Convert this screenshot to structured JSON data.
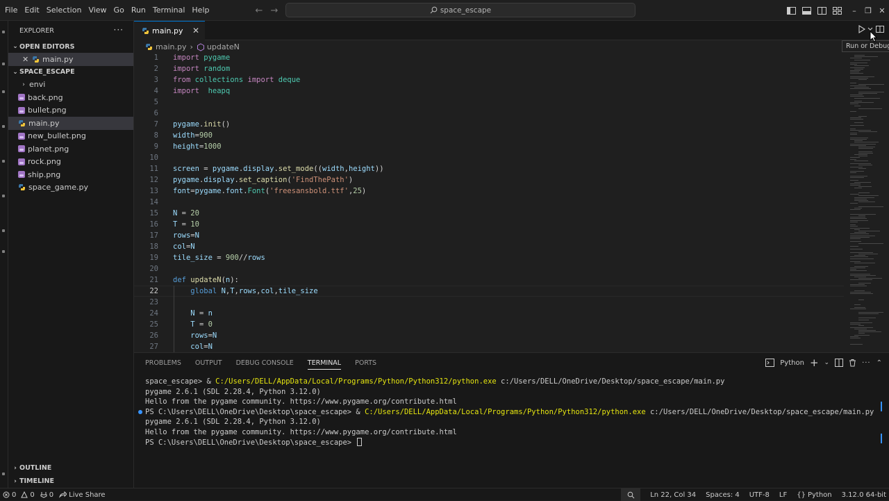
{
  "menu": [
    "File",
    "Edit",
    "Selection",
    "View",
    "Go",
    "Run",
    "Terminal",
    "Help"
  ],
  "search": {
    "label": "space_escape"
  },
  "sidebar": {
    "title": "EXPLORER",
    "open_editors": {
      "title": "OPEN EDITORS",
      "items": [
        {
          "name": "main.py"
        }
      ]
    },
    "folder": {
      "title": "SPACE_ESCAPE",
      "items": [
        {
          "name": "envi",
          "type": "folder"
        },
        {
          "name": "back.png",
          "type": "image"
        },
        {
          "name": "bullet.png",
          "type": "image"
        },
        {
          "name": "main.py",
          "type": "python",
          "selected": true
        },
        {
          "name": "new_bullet.png",
          "type": "image"
        },
        {
          "name": "planet.png",
          "type": "image"
        },
        {
          "name": "rock.png",
          "type": "image"
        },
        {
          "name": "ship.png",
          "type": "image"
        },
        {
          "name": "space_game.py",
          "type": "python"
        }
      ]
    },
    "outline": "OUTLINE",
    "timeline": "TIMELINE"
  },
  "tab": {
    "label": "main.py",
    "close": "✕"
  },
  "breadcrumb": {
    "file": "main.py",
    "separator": "›",
    "symbol": "updateN"
  },
  "tooltip": "Run or Debug",
  "editor": {
    "current_line": 22,
    "lines": [
      {
        "n": "1",
        "tokens": [
          [
            "kw",
            "import"
          ],
          [
            "op",
            " "
          ],
          [
            "mod",
            "pygame"
          ]
        ]
      },
      {
        "n": "2",
        "tokens": [
          [
            "kw",
            "import"
          ],
          [
            "op",
            " "
          ],
          [
            "mod",
            "random"
          ]
        ]
      },
      {
        "n": "3",
        "tokens": [
          [
            "kw",
            "from"
          ],
          [
            "op",
            " "
          ],
          [
            "mod",
            "collections"
          ],
          [
            "op",
            " "
          ],
          [
            "kw",
            "import"
          ],
          [
            "op",
            " "
          ],
          [
            "mod",
            "deque"
          ]
        ]
      },
      {
        "n": "4",
        "tokens": [
          [
            "kw",
            "import"
          ],
          [
            "op",
            "  "
          ],
          [
            "mod",
            "heapq"
          ]
        ]
      },
      {
        "n": "5",
        "tokens": []
      },
      {
        "n": "6",
        "tokens": []
      },
      {
        "n": "7",
        "tokens": [
          [
            "var",
            "pygame"
          ],
          [
            "op",
            "."
          ],
          [
            "fn",
            "init"
          ],
          [
            "op",
            "()"
          ]
        ]
      },
      {
        "n": "8",
        "tokens": [
          [
            "var",
            "width"
          ],
          [
            "op",
            "="
          ],
          [
            "num",
            "900"
          ]
        ]
      },
      {
        "n": "9",
        "tokens": [
          [
            "var",
            "height"
          ],
          [
            "op",
            "="
          ],
          [
            "num",
            "1000"
          ]
        ]
      },
      {
        "n": "10",
        "tokens": []
      },
      {
        "n": "11",
        "tokens": [
          [
            "var",
            "screen"
          ],
          [
            "op",
            " = "
          ],
          [
            "var",
            "pygame"
          ],
          [
            "op",
            "."
          ],
          [
            "var",
            "display"
          ],
          [
            "op",
            "."
          ],
          [
            "fn",
            "set_mode"
          ],
          [
            "op",
            "(("
          ],
          [
            "var",
            "width"
          ],
          [
            "op",
            ","
          ],
          [
            "var",
            "height"
          ],
          [
            "op",
            "))"
          ]
        ]
      },
      {
        "n": "12",
        "tokens": [
          [
            "var",
            "pygame"
          ],
          [
            "op",
            "."
          ],
          [
            "var",
            "display"
          ],
          [
            "op",
            "."
          ],
          [
            "fn",
            "set_caption"
          ],
          [
            "op",
            "("
          ],
          [
            "str",
            "'FindThePath'"
          ],
          [
            "op",
            ")"
          ]
        ]
      },
      {
        "n": "13",
        "tokens": [
          [
            "var",
            "font"
          ],
          [
            "op",
            "="
          ],
          [
            "var",
            "pygame"
          ],
          [
            "op",
            "."
          ],
          [
            "var",
            "font"
          ],
          [
            "op",
            "."
          ],
          [
            "mod",
            "Font"
          ],
          [
            "op",
            "("
          ],
          [
            "str",
            "'freesansbold.ttf'"
          ],
          [
            "op",
            ","
          ],
          [
            "num",
            "25"
          ],
          [
            "op",
            ")"
          ]
        ]
      },
      {
        "n": "14",
        "tokens": []
      },
      {
        "n": "15",
        "tokens": [
          [
            "var",
            "N"
          ],
          [
            "op",
            " = "
          ],
          [
            "num",
            "20"
          ]
        ]
      },
      {
        "n": "16",
        "tokens": [
          [
            "var",
            "T"
          ],
          [
            "op",
            " = "
          ],
          [
            "num",
            "10"
          ]
        ]
      },
      {
        "n": "17",
        "tokens": [
          [
            "var",
            "rows"
          ],
          [
            "op",
            "="
          ],
          [
            "var",
            "N"
          ]
        ]
      },
      {
        "n": "18",
        "tokens": [
          [
            "var",
            "col"
          ],
          [
            "op",
            "="
          ],
          [
            "var",
            "N"
          ]
        ]
      },
      {
        "n": "19",
        "tokens": [
          [
            "var",
            "tile_size"
          ],
          [
            "op",
            " = "
          ],
          [
            "num",
            "900"
          ],
          [
            "op",
            "//"
          ],
          [
            "var",
            "rows"
          ]
        ]
      },
      {
        "n": "20",
        "tokens": []
      },
      {
        "n": "21",
        "tokens": [
          [
            "def",
            "def"
          ],
          [
            "op",
            " "
          ],
          [
            "fn",
            "updateN"
          ],
          [
            "op",
            "("
          ],
          [
            "var",
            "n"
          ],
          [
            "op",
            "):"
          ]
        ]
      },
      {
        "n": "22",
        "tokens": [
          [
            "op",
            "    "
          ],
          [
            "def",
            "global"
          ],
          [
            "op",
            " "
          ],
          [
            "var",
            "N"
          ],
          [
            "op",
            ","
          ],
          [
            "var",
            "T"
          ],
          [
            "op",
            ","
          ],
          [
            "var",
            "rows"
          ],
          [
            "op",
            ","
          ],
          [
            "var",
            "col"
          ],
          [
            "op",
            ","
          ],
          [
            "var",
            "tile_size"
          ]
        ]
      },
      {
        "n": "23",
        "tokens": []
      },
      {
        "n": "24",
        "tokens": [
          [
            "op",
            "    "
          ],
          [
            "var",
            "N"
          ],
          [
            "op",
            " = "
          ],
          [
            "var",
            "n"
          ]
        ]
      },
      {
        "n": "25",
        "tokens": [
          [
            "op",
            "    "
          ],
          [
            "var",
            "T"
          ],
          [
            "op",
            " = "
          ],
          [
            "num",
            "0"
          ]
        ]
      },
      {
        "n": "26",
        "tokens": [
          [
            "op",
            "    "
          ],
          [
            "var",
            "rows"
          ],
          [
            "op",
            "="
          ],
          [
            "var",
            "N"
          ]
        ]
      },
      {
        "n": "27",
        "tokens": [
          [
            "op",
            "    "
          ],
          [
            "var",
            "col"
          ],
          [
            "op",
            "="
          ],
          [
            "var",
            "N"
          ]
        ]
      }
    ]
  },
  "panel": {
    "tabs": [
      "PROBLEMS",
      "OUTPUT",
      "DEBUG CONSOLE",
      "TERMINAL",
      "PORTS"
    ],
    "active_tab": "TERMINAL",
    "shell": "Python"
  },
  "terminal": {
    "lines": [
      {
        "dot": false,
        "parts": [
          [
            "n",
            "space_escape> & "
          ],
          [
            "y",
            "C:/Users/DELL/AppData/Local/Programs/Python/Python312/python.exe"
          ],
          [
            "n",
            " c:/Users/DELL/OneDrive/Desktop/space_escape/main.py"
          ]
        ]
      },
      {
        "dot": false,
        "parts": [
          [
            "n",
            "pygame 2.6.1 (SDL 2.28.4, Python 3.12.0)"
          ]
        ]
      },
      {
        "dot": false,
        "parts": [
          [
            "n",
            "Hello from the pygame community. https://www.pygame.org/contribute.html"
          ]
        ]
      },
      {
        "dot": true,
        "parts": [
          [
            "n",
            "PS C:\\Users\\DELL\\OneDrive\\Desktop\\space_escape> & "
          ],
          [
            "y",
            "C:/Users/DELL/AppData/Local/Programs/Python/Python312/python.exe"
          ],
          [
            "n",
            " c:/Users/DELL/OneDrive/Desktop/space_escape/main.py"
          ]
        ]
      },
      {
        "dot": false,
        "parts": [
          [
            "n",
            "pygame 2.6.1 (SDL 2.28.4, Python 3.12.0)"
          ]
        ]
      },
      {
        "dot": false,
        "parts": [
          [
            "n",
            "Hello from the pygame community. https://www.pygame.org/contribute.html"
          ]
        ]
      },
      {
        "dot": false,
        "parts": [
          [
            "n",
            "PS C:\\Users\\DELL\\OneDrive\\Desktop\\space_escape> "
          ]
        ],
        "caret": true
      }
    ]
  },
  "status": {
    "errors": "0",
    "warnings": "0",
    "ports": "0",
    "live_share": "Live Share",
    "position": "Ln 22, Col 34",
    "spaces": "Spaces: 4",
    "encoding": "UTF-8",
    "eol": "LF",
    "language": "Python",
    "interpreter": "3.12.0 64-bit"
  },
  "colors": {
    "accent": "#0078d4",
    "keyword": "#c586c0",
    "function": "#dcdcaa",
    "variable": "#9cdcfe",
    "string": "#ce9178",
    "number": "#b5cea8"
  }
}
